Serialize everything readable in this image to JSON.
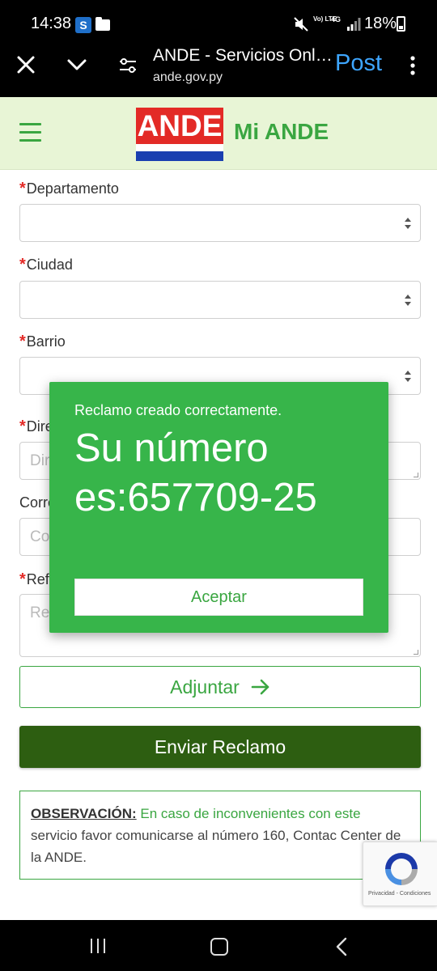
{
  "status_bar": {
    "time": "14:38",
    "s_badge": "S",
    "network_volte": "Vo) LTE",
    "network_4g": "4G",
    "battery": "18%"
  },
  "browser": {
    "title": "ANDE - Servicios Online",
    "url": "ande.gov.py",
    "post_label": "Post"
  },
  "site": {
    "logo_text": "ANDE",
    "title": "Mi ANDE"
  },
  "form": {
    "required_mark": "*",
    "departamento_label": "Departamento",
    "ciudad_label": "Ciudad",
    "barrio_label": "Barrio",
    "direccion_label": "Dirección",
    "direccion_placeholder": "Dirección",
    "correo_label": "Correo",
    "correo_placeholder": "Correo",
    "referencia_label": "Referencia",
    "referencia_placeholder": "Referencia",
    "adjuntar_label": "Adjuntar",
    "enviar_label": "Enviar Reclamo"
  },
  "observacion": {
    "title": "OBSERVACIÓN:",
    "text": " En caso de inconvenientes con este",
    "text2": "servicio favor comunicarse al número 160, Contac Center de la ANDE."
  },
  "recaptcha": {
    "footer": "Privacidad - Condiciones"
  },
  "modal": {
    "subtitle": "Reclamo creado correctamente.",
    "number_text": "Su número es:657709-25",
    "accept_label": "Aceptar"
  },
  "colors": {
    "brand_green": "#3aa641",
    "dark_green": "#2d5e11",
    "modal_green": "#37b54a",
    "logo_red": "#e32a26",
    "logo_blue": "#1a3fb0"
  }
}
